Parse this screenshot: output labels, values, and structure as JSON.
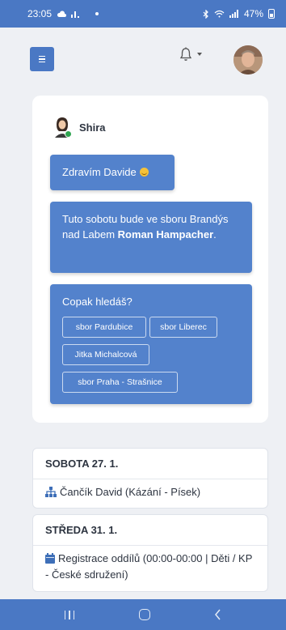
{
  "status_bar": {
    "time": "23:05",
    "battery": "47%"
  },
  "header": {
    "menu_icon": "hamburger-icon",
    "notification_icon": "bell-icon"
  },
  "chat": {
    "bot_name": "Shira",
    "greeting": "Zdravím Davide",
    "info_prefix": "Tuto sobotu bude ve sboru Brandýs nad Labem ",
    "info_name": "Roman Hampacher",
    "info_suffix": ".",
    "question": "Copak hledáš?",
    "suggestions": [
      "sbor Pardubice",
      "sbor Liberec",
      "Jitka Michalcová",
      "sbor Praha - Strašnice"
    ]
  },
  "events": [
    {
      "date": "SOBOTA 27. 1.",
      "icon": "sitemap-icon",
      "text": "Čančík David (Kázání - Písek)"
    },
    {
      "date": "STŘEDA 31. 1.",
      "icon": "calendar-icon",
      "text": "Registrace oddílů (00:00-00:00 | Děti / KP - České sdružení)"
    }
  ],
  "colors": {
    "accent": "#4a78c4",
    "bubble": "#5382cc",
    "online": "#2ea44f"
  }
}
